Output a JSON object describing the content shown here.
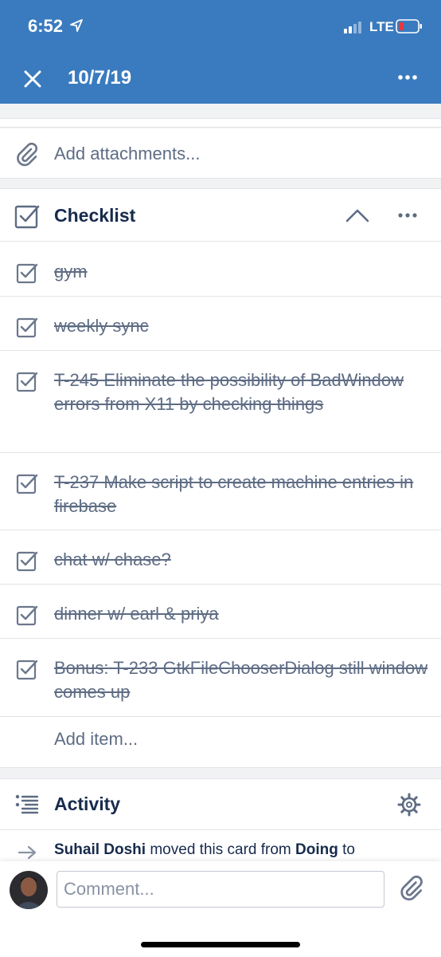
{
  "status_bar": {
    "time": "6:52",
    "network": "LTE",
    "battery_color": "#e8373e"
  },
  "header": {
    "title": "10/7/19",
    "bg_color": "#3a7bbf"
  },
  "attachments": {
    "label": "Add attachments..."
  },
  "checklist": {
    "title": "Checklist",
    "items": [
      {
        "text": "gym",
        "checked": true
      },
      {
        "text": "weekly sync",
        "checked": true
      },
      {
        "text": "T-245 Eliminate the possibility of BadWindow errors from X11 by checking things",
        "checked": true
      },
      {
        "text": "T-237 Make script to create machine entries in firebase",
        "checked": true
      },
      {
        "text": "chat w/ chase?",
        "checked": true
      },
      {
        "text": "dinner w/ earl & priya",
        "checked": true
      },
      {
        "text": "Bonus: T-233 GtkFileChooserDialog still window comes up",
        "checked": true
      }
    ],
    "add_item_label": "Add item..."
  },
  "activity": {
    "title": "Activity",
    "entries": [
      {
        "user": "Suhail Doshi",
        "action": "moved this card from",
        "from": "Doing",
        "to_word": "to"
      }
    ]
  },
  "comment": {
    "placeholder": "Comment..."
  }
}
